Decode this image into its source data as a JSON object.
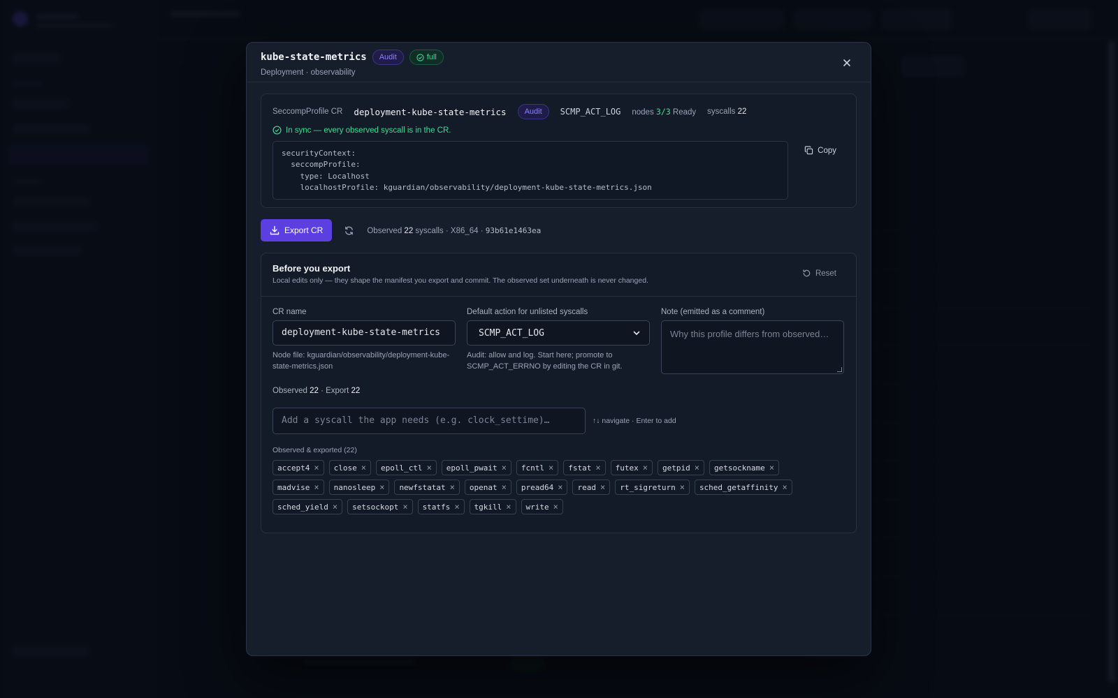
{
  "modal": {
    "title": "kube-state-metrics",
    "badge_mode": "Audit",
    "badge_coverage": "full",
    "subtitle": "Deployment · observability",
    "close_icon": "close-icon"
  },
  "cr": {
    "kind_label": "SeccompProfile CR",
    "name": "deployment-kube-state-metrics",
    "mode_badge": "Audit",
    "default_action": "SCMP_ACT_LOG",
    "nodes_label": "nodes",
    "nodes_value": "3/3",
    "nodes_status": "Ready",
    "syscalls_label": "syscalls",
    "syscalls_value": "22",
    "sync_message": "In sync — every observed syscall is in the CR.",
    "copy_label": "Copy",
    "snippet": [
      "securityContext:",
      "  seccompProfile:",
      "    type: Localhost",
      "    localhostProfile: kguardian/observability/deployment-kube-state-metrics.json"
    ]
  },
  "export": {
    "button_label": "Export CR",
    "observed_prefix": "Observed",
    "observed_count": "22",
    "observed_suffix": "syscalls · X86_64 ·",
    "hash": "93b61e1463ea"
  },
  "before_export": {
    "title": "Before you export",
    "description": "Local edits only — they shape the manifest you export and commit. The observed set underneath is never changed.",
    "reset_label": "Reset",
    "cr_name_label": "CR name",
    "cr_name_value": "deployment-kube-state-metrics",
    "node_file_help": "Node file: kguardian/observability/deployment-kube-state-metrics.json",
    "default_action_label": "Default action for unlisted syscalls",
    "default_action_value": "SCMP_ACT_LOG",
    "default_action_help": "Audit: allow and log. Start here; promote to SCMP_ACT_ERRNO by editing the CR in git.",
    "note_label": "Note (emitted as a comment)",
    "note_placeholder": "Why this profile differs from observed…",
    "observed_label": "Observed",
    "observed_count": "22",
    "export_label": "· Export",
    "export_count": "22",
    "add_placeholder": "Add a syscall the app needs (e.g. clock_settime)…",
    "add_hint": "↑↓ navigate · Enter to add",
    "chips_label": "Observed & exported (22)",
    "syscalls": [
      "accept4",
      "close",
      "epoll_ctl",
      "epoll_pwait",
      "fcntl",
      "fstat",
      "futex",
      "getpid",
      "getsockname",
      "madvise",
      "nanosleep",
      "newfstatat",
      "openat",
      "pread64",
      "read",
      "rt_sigreturn",
      "sched_getaffinity",
      "sched_yield",
      "setsockopt",
      "statfs",
      "tgkill",
      "write"
    ]
  },
  "colors": {
    "accent": "#5b3fe0",
    "success": "#3ddc97",
    "audit": "#8b82ff",
    "surface": "#161e2c"
  }
}
